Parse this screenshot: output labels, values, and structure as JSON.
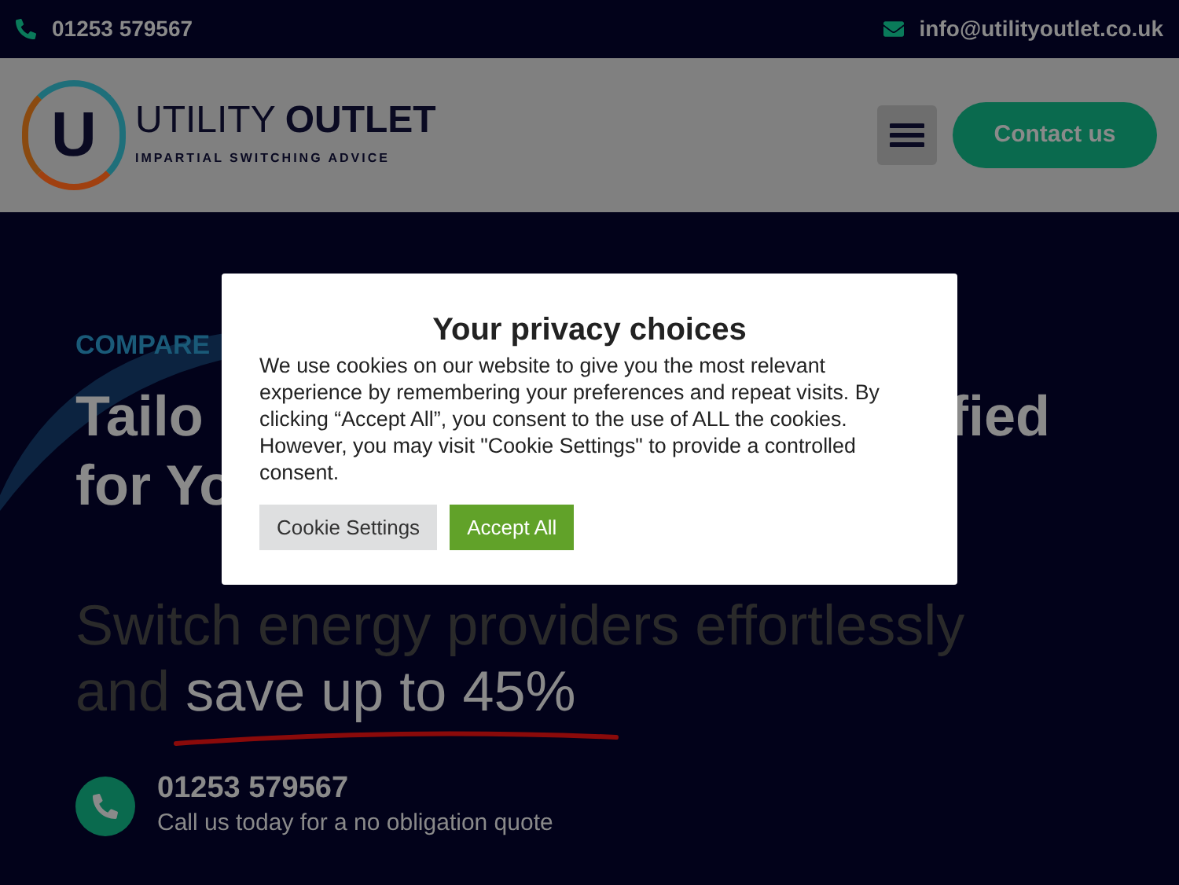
{
  "top_bar": {
    "phone": "01253 579567",
    "email": "info@utilityoutlet.co.uk"
  },
  "header": {
    "logo_letter": "U",
    "logo_name_light": "UTILITY",
    "logo_name_bold": "OUTLET",
    "logo_tagline": "IMPARTIAL SWITCHING ADVICE",
    "contact_button": "Contact us"
  },
  "hero": {
    "eyebrow": "COMPARE",
    "headline_left": "Tailo",
    "headline_right": "fied",
    "headline_line_2": "for Yo",
    "subtitle_line_1": "Switch energy providers effortlessly",
    "subtitle_lead": "and",
    "subtitle_highlight": "save up to 45%",
    "call_number": "01253 579567",
    "call_note": "Call us today for a no obligation quote"
  },
  "cookie_dialog": {
    "title": "Your privacy choices",
    "body": "We use cookies on our website to give you the most relevant experience by remembering your preferences and repeat visits. By clicking “Accept All”, you consent to the use of ALL the cookies. However, you may visit \"Cookie Settings\" to provide a controlled consent.",
    "buttons": [
      {
        "label": "Cookie Settings",
        "kind": "secondary"
      },
      {
        "label": "Accept All",
        "kind": "primary"
      }
    ]
  }
}
